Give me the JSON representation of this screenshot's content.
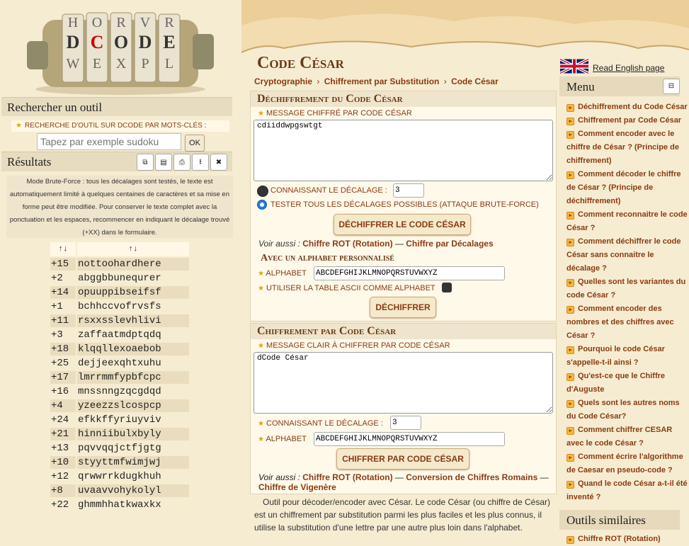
{
  "logo": {
    "text": "DCODE"
  },
  "search": {
    "title": "Rechercher un outil",
    "label": "Recherche d'outil sur dCode par mots-clés :",
    "placeholder": "Tapez par exemple sudoku",
    "ok": "OK"
  },
  "results": {
    "title": "Résultats",
    "tool_buttons": [
      "copy-icon",
      "clipboard-icon",
      "print-icon",
      "download-icon",
      "close-icon"
    ],
    "note": "Mode Brute-Force : tous les décalages sont testés, le texte est automatiquement limité à quelques centaines de caractères et sa mise en forme peut être modifiée. Pour conserver le texte complet avec la ponctuation et les espaces, recommencer en indiquant le décalage trouvé (+XX) dans le formulaire.",
    "col1": "↑↓",
    "col2": "↑↓",
    "rows": [
      [
        "+15",
        "nottoohardhere"
      ],
      [
        "+2",
        "abggbbunequrer"
      ],
      [
        "+14",
        "opuuppibseifsf"
      ],
      [
        "+1",
        "bchhccvofrvsfs"
      ],
      [
        "+11",
        "rsxxsslevhlivi"
      ],
      [
        "+3",
        "zaffaatmdptqdq"
      ],
      [
        "+18",
        "klqqllexoaebob"
      ],
      [
        "+25",
        "dejjeexqhtxuhu"
      ],
      [
        "+17",
        "lmrrmmfypbfcpc"
      ],
      [
        "+16",
        "mnssnngzqcgdqd"
      ],
      [
        "+4",
        "yzeezzslcospcp"
      ],
      [
        "+24",
        "efkkffyriuyviv"
      ],
      [
        "+21",
        "hinniibulxbyly"
      ],
      [
        "+13",
        "pqvvqqjctfjgtg"
      ],
      [
        "+10",
        "styyttmfwimjwj"
      ],
      [
        "+12",
        "qrwwrrkdugkhuh"
      ],
      [
        "+8",
        "uvaavvohykolyl"
      ],
      [
        "+22",
        "ghmmhhatkwaxkx"
      ]
    ]
  },
  "page": {
    "title": "Code César",
    "breadcrumb": [
      "Cryptographie",
      "Chiffrement par Substitution",
      "Code César"
    ],
    "breadcrumb_sep": "›"
  },
  "decrypt": {
    "title": "Déchiffrement du Code César",
    "msg_label": "Message chiffré par Code César",
    "msg_value": "cdiiddwpgswtgt",
    "opt1_label": "Connaissant le décalage :",
    "shift_value": "3",
    "opt2_label": "Tester tous les décalages possibles (attaque brute-force)",
    "button": "DÉCHIFFRER LE CODE CÉSAR",
    "see_also_label": "Voir aussi :",
    "see_also": [
      "Chiffre ROT (Rotation)",
      "Chiffre par Décalages"
    ],
    "see_sep": "—",
    "alpha_title": "Avec un alphabet personnalisé",
    "alpha_label": "Alphabet",
    "alpha_value": "ABCDEFGHIJKLMNOPQRSTUVWXYZ",
    "ascii_label": "Utiliser la table ASCII comme alphabet",
    "button2": "DÉCHIFFRER"
  },
  "encrypt": {
    "title": "Chiffrement par Code César",
    "msg_label": "Message clair à chiffrer par Code César",
    "msg_value": "dCode César",
    "shift_label": "Connaissant le décalage :",
    "shift_value": "3",
    "alpha_label": "Alphabet",
    "alpha_value": "ABCDEFGHIJKLMNOPQRSTUVWXYZ",
    "button": "CHIFFRER PAR CODE CÉSAR",
    "see_also_label": "Voir aussi :",
    "see_also": [
      "Chiffre ROT (Rotation)",
      "Conversion de Chiffres Romains",
      "Chiffre de Vigenère"
    ],
    "see_sep": "—"
  },
  "desc": "Outil pour décoder/encoder avec César. Le code César (ou chiffre de César) est un chiffrement par substitution parmi les plus faciles et les plus connus, il utilise la substitution d'une lettre par une autre plus loin dans l'alphabet.",
  "right": {
    "english_link": "Read English page",
    "menu_title": "Menu",
    "menu_toggle": "⊟",
    "menu": [
      "Déchiffrement du Code César",
      "Chiffrement par Code César",
      "Comment encoder avec le chiffre de César ? (Principe de chiffrement)",
      "Comment décoder le chiffre de César ? (Principe de déchiffrement)",
      "Comment reconnaitre le code César ?",
      "Comment déchiffrer le code César sans connaitre le décalage ?",
      "Quelles sont les variantes du code César ?",
      "Comment encoder des nombres et des chiffres avec César ?",
      "Pourquoi le code César s'appelle-t-il ainsi ?",
      "Qu'est-ce que le Chiffre d'Auguste",
      "Quels sont les autres noms du Code César?",
      "Comment chiffrer CESAR avec le code César ?",
      "Comment écrire l'algorithme de Caesar en pseudo-code ?",
      "Quand le code César a-t-il été inventé ?"
    ],
    "similar_title": "Outils similaires",
    "similar": [
      "Chiffre ROT (Rotation)"
    ]
  },
  "colors": {
    "accent": "#8a3b12",
    "bg": "#f6ecd2",
    "panel": "#fff9ea"
  }
}
